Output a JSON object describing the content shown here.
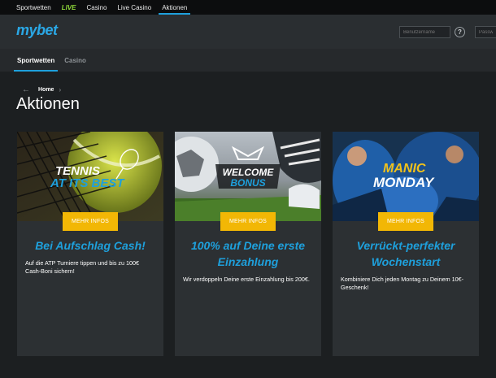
{
  "topnav": {
    "items": [
      {
        "label": "Sportwetten"
      },
      {
        "label": "LIVE"
      },
      {
        "label": "Casino"
      },
      {
        "label": "Live Casino"
      },
      {
        "label": "Aktionen"
      }
    ]
  },
  "header": {
    "logo": "mybet",
    "login": {
      "username_placeholder": "Benutzername",
      "password_placeholder": "Passwort",
      "help_label": "?"
    }
  },
  "subnav": {
    "tabs": [
      {
        "label": "Sportwetten"
      },
      {
        "label": "Casino"
      }
    ]
  },
  "breadcrumb": {
    "home": "Home"
  },
  "page_title": "Aktionen",
  "promos": [
    {
      "banner_line1": "TENNIS",
      "banner_line2": "AT ITS BEST",
      "button": "MEHR INFOS",
      "headline": "Bei Aufschlag Cash!",
      "description": "Auf die ATP Turniere tippen und bis zu 100€ Cash-Boni sichern!"
    },
    {
      "banner_line1": "WELCOME",
      "banner_line2": "BONUS",
      "button": "MEHR INFOS",
      "headline": "100% auf Deine erste Einzahlung",
      "description": "Wir verdoppeln Deine erste Einzahlung bis 200€."
    },
    {
      "banner_line1": "MANIC",
      "banner_line2": "MONDAY",
      "button": "MEHR INFOS",
      "headline": "Verrückt-perfekter Wochenstart",
      "description": "Kombiniere Dich jeden Montag zu Deinem 10€-Geschenk!"
    }
  ],
  "colors": {
    "accent": "#1ea0dc",
    "button": "#f2b705",
    "live": "#8fd93a"
  }
}
